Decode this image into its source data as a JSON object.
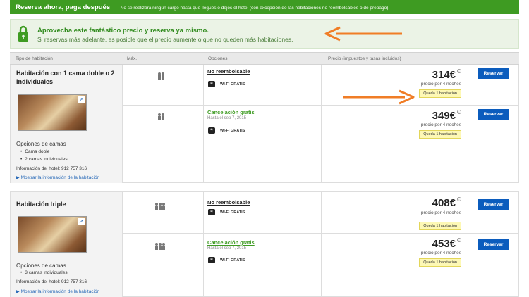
{
  "topbar": {
    "title": "Reserva ahora, paga después",
    "text": "No se realizará ningún cargo hasta que llegues o dejes el hotel (con excepción de las habitaciones no reembolsables o de prepago)."
  },
  "promo": {
    "title": "Aprovecha este fantástico precio y reserva ya mismo.",
    "subtitle": "Si reservas más adelante, es posible que el precio aumente o que no queden más habitaciones."
  },
  "table_header": {
    "room_type": "Tipo de habitación",
    "max": "Máx.",
    "options": "Opciones",
    "price": "Precio (impuestos y tasas incluidos)"
  },
  "rooms": [
    {
      "name": "Habitación con 1 cama doble o 2 individuales",
      "bed_options_label": "Opciones de camas",
      "bed_options": [
        "Cama doble",
        "2 camas individuales"
      ],
      "hotel_info": "Información del hotel: 912 757 316",
      "show_info": "Mostrar la información de la habitación",
      "offers": [
        {
          "max_persons": 2,
          "option": "No reembolsable",
          "option_sub": "",
          "amenity": "WI-FI GRATIS",
          "price": "314€",
          "nights": "precio por 4 noches",
          "badge": "Queda 1 habitación",
          "button": "Reservar"
        },
        {
          "max_persons": 2,
          "option": "Cancelación gratis",
          "option_sub": "Hasta el sep 7, 2015",
          "amenity": "WI-FI GRATIS",
          "price": "349€",
          "nights": "precio por 4 noches",
          "badge": "Queda 1 habitación",
          "button": "Reservar"
        }
      ]
    },
    {
      "name": "Habitación triple",
      "bed_options_label": "Opciones de camas",
      "bed_options": [
        "3 camas individuales"
      ],
      "hotel_info": "Información del hotel: 912 757 316",
      "show_info": "Mostrar la información de la habitación",
      "offers": [
        {
          "max_persons": 3,
          "option": "No reembolsable",
          "option_sub": "",
          "amenity": "WI-FI GRATIS",
          "price": "408€",
          "nights": "precio por 4 noches",
          "badge": "Queda 1 habitación",
          "button": "Reservar"
        },
        {
          "max_persons": 3,
          "option": "Cancelación gratis",
          "option_sub": "Hasta el sep 7, 2015",
          "amenity": "WI-FI GRATIS",
          "price": "453€",
          "nights": "precio por 4 noches",
          "badge": "Queda 1 habitación",
          "button": "Reservar"
        }
      ]
    }
  ],
  "colors": {
    "brand_green": "#3e9b22",
    "reserve_blue": "#0b5cbd",
    "badge_yellow": "#fdf8b5",
    "arrow_orange": "#f07d26"
  }
}
